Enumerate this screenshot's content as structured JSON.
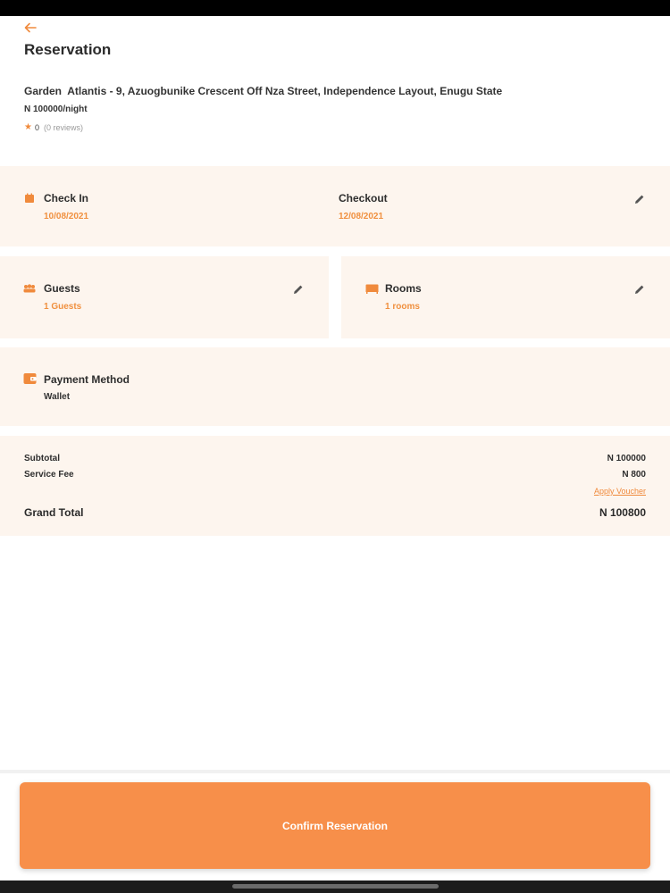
{
  "header": {
    "back_icon": "arrow-left-icon",
    "title": "Reservation"
  },
  "hotel": {
    "name": "Garden  Atlantis - 9, Azuogbunike Crescent Off Nza Street, Independence Layout, Enugu State",
    "price": "N 100000/night",
    "rating": "0",
    "reviews": "(0 reviews)"
  },
  "dates": {
    "check_in_label": "Check In",
    "check_in_value": "10/08/2021",
    "checkout_label": "Checkout",
    "checkout_value": "12/08/2021",
    "calendar_icon": "calendar-icon",
    "edit_icon": "pencil-icon"
  },
  "guests": {
    "label": "Guests",
    "value": "1 Guests",
    "icon": "people-icon"
  },
  "rooms": {
    "label": "Rooms",
    "value": "1 rooms",
    "icon": "bed-icon"
  },
  "payment": {
    "label": "Payment Method",
    "value": "Wallet",
    "icon": "wallet-icon"
  },
  "totals": {
    "subtotal_label": "Subtotal",
    "subtotal_value": "N 100000",
    "service_fee_label": "Service Fee",
    "service_fee_value": "N 800",
    "voucher_link": "Apply Voucher",
    "grand_total_label": "Grand Total",
    "grand_total_value": "N 100800"
  },
  "actions": {
    "confirm_label": "Confirm Reservation"
  },
  "colors": {
    "accent": "#f08a3c",
    "button": "#f78f4a",
    "panel_bg": "#fdf5ee"
  }
}
